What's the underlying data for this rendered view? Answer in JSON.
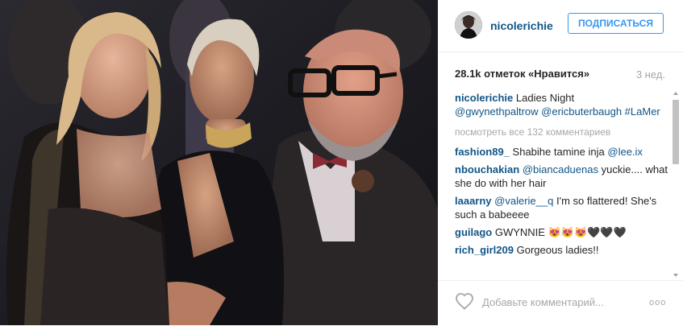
{
  "post": {
    "username": "nicolerichie",
    "follow_label": "ПОДПИСАТЬСЯ",
    "likes": "28.1k отметок «Нравится»",
    "time_ago": "3 нед.",
    "caption": {
      "user": "nicolerichie",
      "text": "Ladies Night",
      "tags": "@gwynethpaltrow @ericbuterbaugh #LaMer"
    },
    "view_all": "посмотреть все 132 комментариев",
    "comments": [
      {
        "user": "fashion89_",
        "mention": "",
        "text": "Shabihe tamine inja",
        "trail_mention": "@lee.ix"
      },
      {
        "user": "nbouchakian",
        "mention": "@biancaduenas",
        "text": "yuckie.... what she do with her hair",
        "trail_mention": ""
      },
      {
        "user": "laaarny",
        "mention": "@valerie__q",
        "text": "I'm so flattered! She's such a babeeee",
        "trail_mention": ""
      },
      {
        "user": "guilago",
        "mention": "",
        "text": "GWYNNIE 😻😻😻🖤🖤🖤",
        "trail_mention": ""
      },
      {
        "user": "rich_girl209",
        "mention": "",
        "text": "Gorgeous ladies!!",
        "trail_mention": ""
      }
    ],
    "comment_placeholder": "Добавьте комментарий...",
    "more_options": "ooo"
  },
  "icons": {
    "like": "heart-outline-icon",
    "more": "ellipsis-icon"
  },
  "colors": {
    "link": "#125688",
    "follow": "#3897f0",
    "muted": "#a5a7aa"
  }
}
